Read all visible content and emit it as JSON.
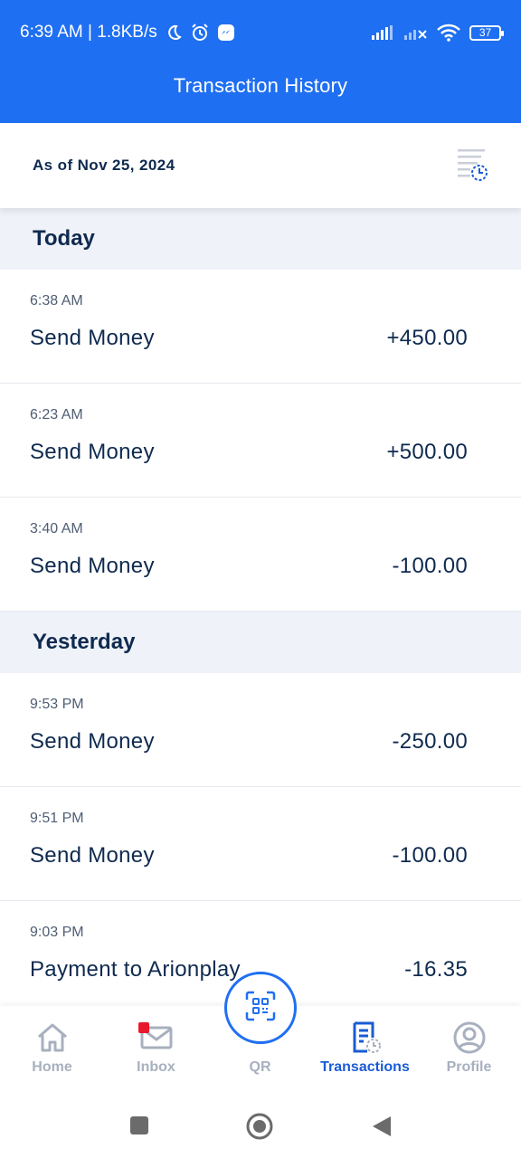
{
  "status_bar": {
    "time_speed": "6:39 AM | 1.8KB/s",
    "battery": "37",
    "icons": [
      "moon-icon",
      "alarm-icon",
      "messenger-icon",
      "signal-icon",
      "signal-x-icon",
      "wifi-icon",
      "battery-icon"
    ]
  },
  "header": {
    "title": "Transaction History"
  },
  "summary": {
    "as_of": "As of Nov 25, 2024",
    "filter_icon": "history-filter-icon"
  },
  "sections": [
    {
      "label": "Today",
      "items": [
        {
          "time": "6:38 AM",
          "name": "Send Money",
          "amount": "+450.00"
        },
        {
          "time": "6:23 AM",
          "name": "Send Money",
          "amount": "+500.00"
        },
        {
          "time": "3:40 AM",
          "name": "Send Money",
          "amount": "-100.00"
        }
      ]
    },
    {
      "label": "Yesterday",
      "items": [
        {
          "time": "9:53 PM",
          "name": "Send Money",
          "amount": "-250.00"
        },
        {
          "time": "9:51 PM",
          "name": "Send Money",
          "amount": "-100.00"
        },
        {
          "time": "9:03 PM",
          "name": "Payment to Arionplay",
          "amount": "-16.35"
        }
      ]
    }
  ],
  "bottom_nav": {
    "items": [
      {
        "label": "Home",
        "icon": "home-icon"
      },
      {
        "label": "Inbox",
        "icon": "mail-icon"
      },
      {
        "label": "QR",
        "icon": "qr-scan-icon"
      },
      {
        "label": "Transactions",
        "icon": "transactions-icon",
        "active": true
      },
      {
        "label": "Profile",
        "icon": "profile-icon"
      }
    ]
  },
  "colors": {
    "brand": "#1f6ff2",
    "active_nav": "#1a5bd4",
    "text": "#0f2a4f",
    "section_bg": "#eff2f8",
    "badge": "#e8192c"
  }
}
